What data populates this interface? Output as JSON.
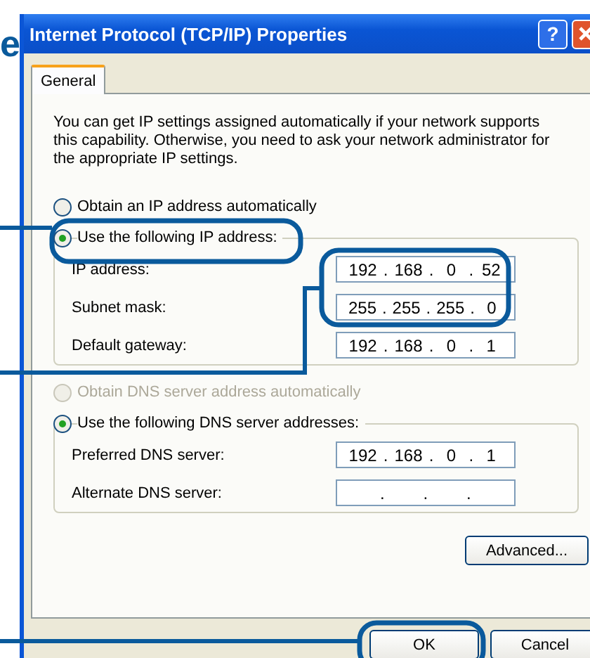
{
  "callout_fragment": "e",
  "window": {
    "title": "Internet Protocol (TCP/IP) Properties",
    "help_button": "?"
  },
  "tabs": [
    {
      "label": "General",
      "selected": true
    }
  ],
  "description": "You can get IP settings assigned automatically if your network supports this capability. Otherwise, you need to ask your network administrator for the appropriate IP settings.",
  "octet_separator": ".",
  "ip_section": {
    "options": [
      {
        "label": "Obtain an IP address automatically",
        "selected": false,
        "disabled": false
      },
      {
        "label": "Use the following IP address:",
        "selected": true,
        "disabled": false
      }
    ],
    "fields": [
      {
        "label": "IP address:",
        "octets": [
          "192",
          "168",
          "0",
          "52"
        ]
      },
      {
        "label": "Subnet mask:",
        "octets": [
          "255",
          "255",
          "255",
          "0"
        ]
      },
      {
        "label": "Default gateway:",
        "octets": [
          "192",
          "168",
          "0",
          "1"
        ]
      }
    ]
  },
  "dns_section": {
    "options": [
      {
        "label": "Obtain DNS server address automatically",
        "selected": false,
        "disabled": true
      },
      {
        "label": "Use the following DNS server addresses:",
        "selected": true,
        "disabled": false
      }
    ],
    "fields": [
      {
        "label": "Preferred DNS server:",
        "octets": [
          "192",
          "168",
          "0",
          "1"
        ]
      },
      {
        "label": "Alternate DNS server:"
      }
    ]
  },
  "advanced_button": "Advanced...",
  "buttons": [
    "OK",
    "Cancel"
  ]
}
